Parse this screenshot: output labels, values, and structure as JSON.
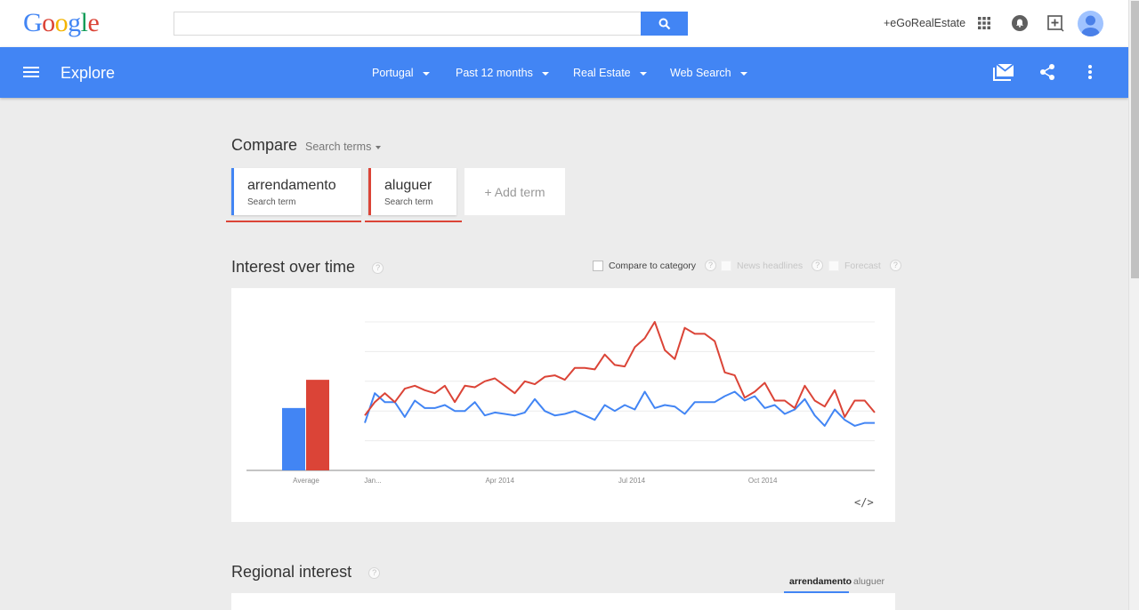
{
  "header": {
    "logo_letters": [
      {
        "ch": "G",
        "color": "#4285f4"
      },
      {
        "ch": "o",
        "color": "#db4437"
      },
      {
        "ch": "o",
        "color": "#f4b400"
      },
      {
        "ch": "g",
        "color": "#4285f4"
      },
      {
        "ch": "l",
        "color": "#0f9d58"
      },
      {
        "ch": "e",
        "color": "#db4437"
      }
    ],
    "search_value": "",
    "search_placeholder": "",
    "account_name": "+eGoRealEstate",
    "icons": [
      "apps-icon",
      "notifications-icon",
      "share-add-icon",
      "avatar"
    ]
  },
  "toolbar": {
    "title": "Explore",
    "filters": [
      {
        "label": "Portugal"
      },
      {
        "label": "Past 12 months"
      },
      {
        "label": "Real Estate"
      },
      {
        "label": "Web Search"
      }
    ],
    "actions": [
      "subscribe-icon",
      "share-icon",
      "more-icon"
    ]
  },
  "compare": {
    "title": "Compare",
    "mode": "Search terms",
    "terms": [
      {
        "name": "arrendamento",
        "type": "Search term",
        "color": "#4285f4"
      },
      {
        "name": "aluguer",
        "type": "Search term",
        "color": "#db4437"
      }
    ],
    "add_label": "+ Add term"
  },
  "interest": {
    "title": "Interest over time",
    "help": "?",
    "options": [
      {
        "label": "Compare to category",
        "checked": false,
        "enabled": true
      },
      {
        "label": "News headlines",
        "checked": false,
        "enabled": false
      },
      {
        "label": "Forecast",
        "checked": false,
        "enabled": false
      }
    ],
    "embed_label": "</>"
  },
  "chart_data": {
    "type": "line",
    "title": "Interest over time",
    "xlabel": "",
    "ylabel": "",
    "ylim": [
      0,
      100
    ],
    "grid": true,
    "x_tick_labels": [
      "Jan...",
      "Apr 2014",
      "Jul 2014",
      "Oct 2014"
    ],
    "average": {
      "label": "Average",
      "values": [
        {
          "name": "arrendamento",
          "value": 42
        },
        {
          "name": "aluguer",
          "value": 61
        }
      ]
    },
    "series": [
      {
        "name": "arrendamento",
        "color": "#4285f4",
        "values": [
          32,
          52,
          46,
          46,
          36,
          47,
          42,
          42,
          44,
          40,
          40,
          46,
          37,
          39,
          38,
          37,
          39,
          48,
          40,
          37,
          38,
          40,
          37,
          34,
          44,
          40,
          44,
          41,
          53,
          42,
          44,
          43,
          38,
          46,
          46,
          46,
          50,
          53,
          47,
          50,
          42,
          44,
          38,
          41,
          48,
          37,
          30,
          41,
          34,
          30,
          32,
          32
        ]
      },
      {
        "name": "aluguer",
        "color": "#db4437",
        "values": [
          37,
          46,
          52,
          46,
          55,
          57,
          54,
          52,
          57,
          46,
          57,
          56,
          60,
          62,
          57,
          52,
          60,
          58,
          63,
          64,
          61,
          69,
          69,
          68,
          78,
          71,
          70,
          83,
          89,
          100,
          81,
          75,
          96,
          92,
          92,
          87,
          66,
          64,
          49,
          53,
          59,
          47,
          47,
          42,
          57,
          47,
          43,
          54,
          36,
          47,
          47,
          39
        ]
      }
    ]
  },
  "regional": {
    "title": "Regional interest",
    "help": "?",
    "tabs": [
      {
        "label": "arrendamento",
        "active": true
      },
      {
        "label": "aluguer",
        "active": false
      }
    ]
  }
}
